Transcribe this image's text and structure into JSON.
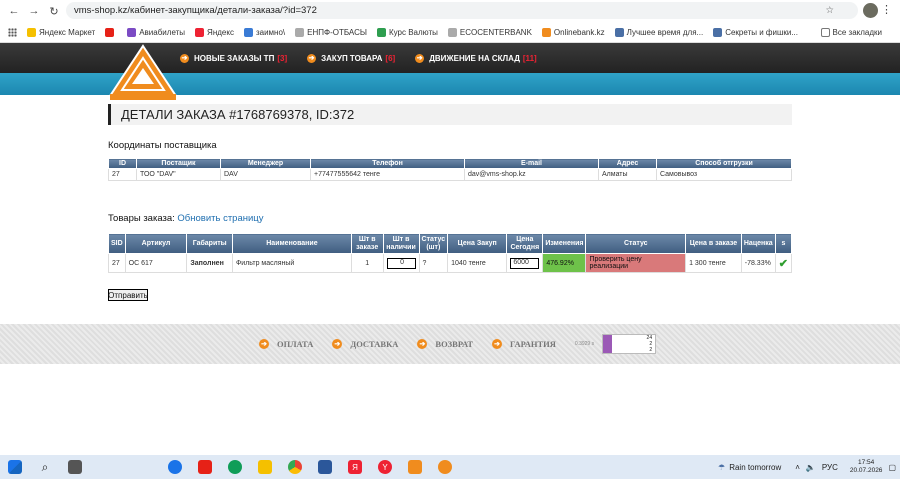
{
  "browser": {
    "url": "vms-shop.kz/кабинет-закупщика/детали-заказа/?id=372",
    "bookmarks": [
      "Яндекс Маркет",
      "Авиабилеты",
      "Яндекс",
      "заимно\\",
      "ЕНПФ-ОТБАСЫ",
      "Курс Валюты",
      "ECOCENTERBANK",
      "Onlinebank.kz",
      "Лучшее время для...",
      "Секреты и фишки..."
    ],
    "all_bookmarks": "Все закладки"
  },
  "nav": {
    "items": [
      {
        "label": "НОВЫЕ ЗАКАЗЫ ТП",
        "count": "[3]"
      },
      {
        "label": "ЗАКУП ТОВАРА",
        "count": "[6]"
      },
      {
        "label": "ДВИЖЕНИЕ НА СКЛАД",
        "count": "[11]"
      }
    ]
  },
  "page": {
    "title": "ДЕТАЛИ ЗАКАЗА #1768769378, ID:372",
    "supplier_heading": "Координаты поставщика",
    "goods_heading": "Товары заказа:",
    "refresh_link": "Обновить страницу",
    "send_button": "Отправить"
  },
  "supplier_table": {
    "headers": [
      "ID",
      "Постащик",
      "Менеджер",
      "Телефон",
      "E-mail",
      "Адрес",
      "Способ отгрузки"
    ],
    "row": [
      "27",
      "ТОО \"DAV\"",
      "DAV",
      "+77477555642 тенге",
      "dav@vms-shop.kz",
      "Алматы",
      "Самовывоз"
    ]
  },
  "goods_table": {
    "headers": [
      "SID",
      "Артикул",
      "Габариты",
      "Наименование",
      "Шт в заказе",
      "Шт в наличии",
      "Статус (шт)",
      "Цена Закуп",
      "Цена Сегодня",
      "Изменения",
      "Статус",
      "Цена в заказе",
      "Наценка",
      "s"
    ],
    "row": {
      "sid": "27",
      "article": "OC 617",
      "dimensions": "Заполнен",
      "name": "Фильтр масляный",
      "qty_order": "1",
      "qty_stock": "0",
      "status_qty": "?",
      "price_purchase": "1040 тенге",
      "price_today": "6000",
      "changes": "476.92%",
      "status": "Проверить цену реализации",
      "price_order": "1 300 тенге",
      "markup": "-78.33%"
    }
  },
  "footer": {
    "items": [
      "ОПЛАТА",
      "ДОСТАВКА",
      "ВОЗВРАТ",
      "ГАРАНТИЯ"
    ],
    "timing": "0.3929 s",
    "counter_lines": [
      "24",
      "2",
      "2"
    ]
  },
  "taskbar": {
    "weather": "Rain tomorrow",
    "lang": "РУС",
    "time": "17:54",
    "date": "20.07.2026"
  },
  "colors": {
    "accent_orange": "#f08c1e",
    "header_blue": "#1c87b0",
    "changes_green": "#6ec24a",
    "status_red": "#d9797a"
  }
}
